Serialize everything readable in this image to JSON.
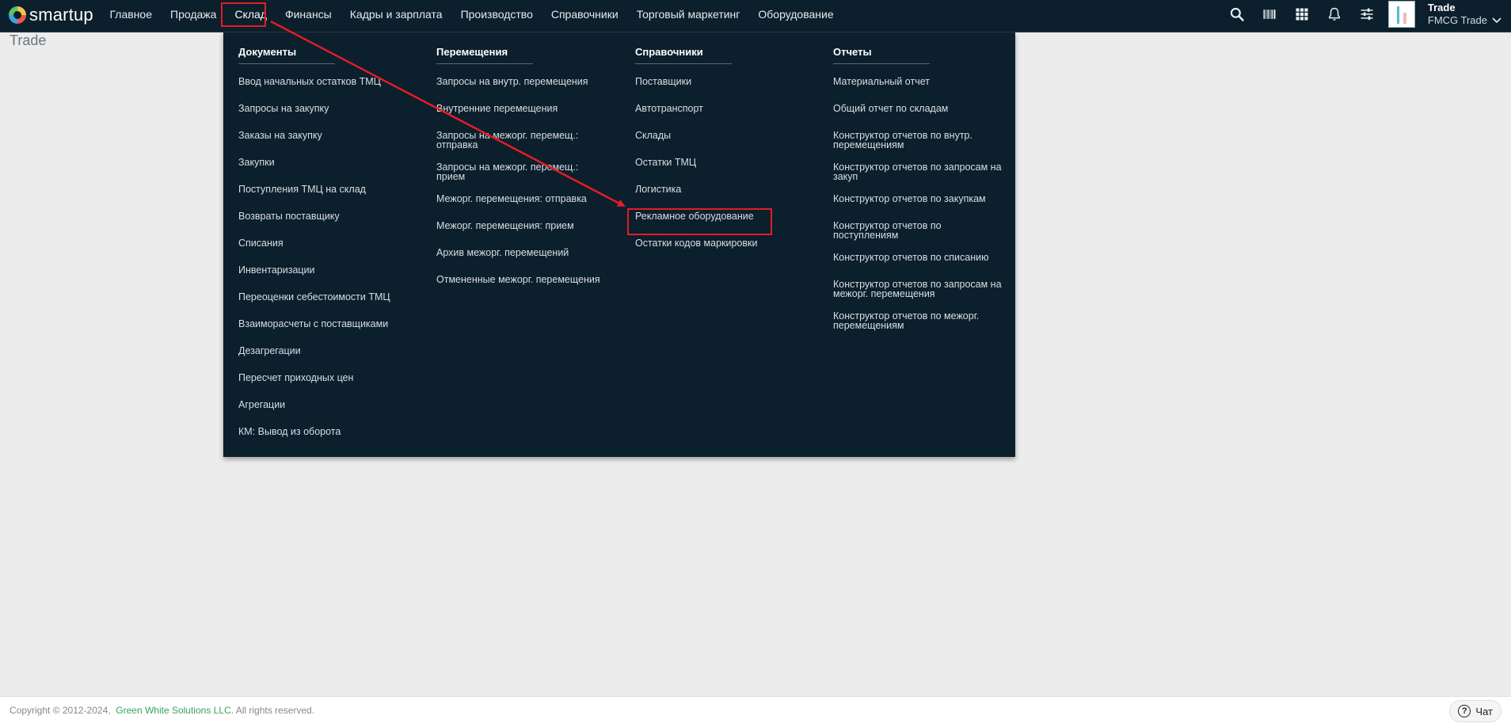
{
  "brand": {
    "logo_text": "smartup"
  },
  "nav": {
    "items": [
      "Главное",
      "Продажа",
      "Склад",
      "Финансы",
      "Кадры и зарплата",
      "Производство",
      "Справочники",
      "Торговый маркетинг",
      "Оборудование"
    ],
    "active": "Склад"
  },
  "user": {
    "name": "Trade",
    "org": "FMCG Trade"
  },
  "page": {
    "title": "Trade"
  },
  "menu": {
    "columns": [
      {
        "header": "Документы",
        "items": [
          [
            "Ввод начальных остатков ТМЦ"
          ],
          [
            "Запросы на закупку"
          ],
          [
            "Заказы на закупку"
          ],
          [
            "Закупки"
          ],
          [
            "Поступления ТМЦ на склад"
          ],
          [
            "Возвраты поставщику"
          ],
          [
            "Списания"
          ],
          [
            "Инвентаризации"
          ],
          [
            "Переоценки себестоимости ТМЦ"
          ],
          [
            "Взаиморасчеты с поставщиками"
          ],
          [
            "Дезагрегации"
          ],
          [
            "Пересчет приходных цен"
          ],
          [
            "Агрегации"
          ],
          [
            "КМ: Вывод из оборота"
          ]
        ]
      },
      {
        "header": "Перемещения",
        "items": [
          [
            "Запросы на внутр. перемещения"
          ],
          [
            "Внутренние перемещения"
          ],
          [
            "Запросы на межорг. перемещ.:",
            "отправка"
          ],
          [
            "Запросы на межорг. перемещ.:",
            "прием"
          ],
          [
            "Межорг. перемещения: отправка"
          ],
          [
            "Межорг. перемещения: прием"
          ],
          [
            "Архив межорг. перемещений"
          ],
          [
            "Отмененные межорг. перемещения"
          ]
        ]
      },
      {
        "header": "Справочники",
        "items": [
          [
            "Поставщики"
          ],
          [
            "Автотранспорт"
          ],
          [
            "Склады"
          ],
          [
            "Остатки ТМЦ"
          ],
          [
            "Логистика"
          ],
          [
            "Рекламное оборудование"
          ],
          [
            "Остатки кодов маркировки"
          ]
        ]
      },
      {
        "header": "Отчеты",
        "items": [
          [
            "Материальный отчет"
          ],
          [
            "Общий отчет по складам"
          ],
          [
            "Конструктор отчетов по внутр.",
            "перемещениям"
          ],
          [
            "Конструктор отчетов по запросам на",
            "закуп"
          ],
          [
            "Конструктор отчетов по закупкам"
          ],
          [
            "Конструктор отчетов по",
            "поступлениям"
          ],
          [
            "Конструктор отчетов по списанию"
          ],
          [
            "Конструктор отчетов по запросам на",
            "межорг. перемещения"
          ],
          [
            "Конструктор отчетов по межорг.",
            "перемещениям"
          ]
        ]
      }
    ]
  },
  "footer": {
    "copyright_prefix": "Copyright © 2012-2024,",
    "company": "Green White Solutions LLC.",
    "rights": "All rights reserved.",
    "chat_label": "Чат"
  },
  "colors": {
    "topbar": "#0c1f2c",
    "highlight": "#e21d25",
    "accent_green": "#3aa35a"
  },
  "icons": [
    "search-icon",
    "barcode-icon",
    "grid-icon",
    "bell-icon",
    "sliders-icon",
    "chevron-down-icon",
    "help-icon"
  ]
}
